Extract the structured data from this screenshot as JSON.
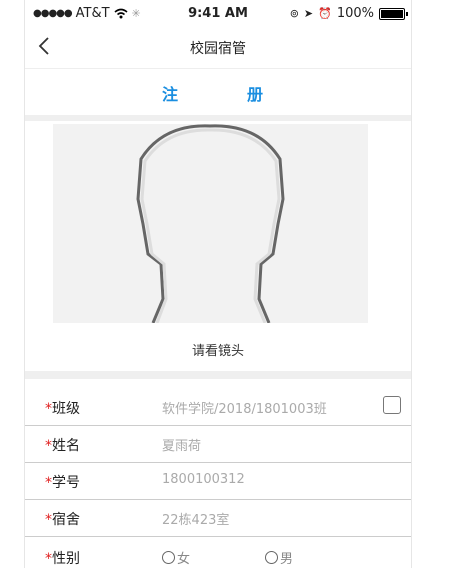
{
  "status_bar": {
    "carrier": "AT&T",
    "time": "9:41 AM",
    "battery": "100%"
  },
  "nav": {
    "title": "校园宿管"
  },
  "tabs": {
    "left": "注",
    "right": "册"
  },
  "photo": {
    "hint": "请看镜头"
  },
  "form": {
    "required_mark": "*",
    "class": {
      "label": "班级",
      "value": "软件学院/2018/1801003班"
    },
    "name": {
      "label": "姓名",
      "value": "夏雨荷"
    },
    "student_id": {
      "label": "学号",
      "value": "1800100312"
    },
    "dorm": {
      "label": "宿舍",
      "value": "22栋423室"
    },
    "gender": {
      "label": "性别",
      "female": "女",
      "male": "男"
    }
  },
  "colors": {
    "accent": "#1a8ee0",
    "required": "#e02020"
  }
}
